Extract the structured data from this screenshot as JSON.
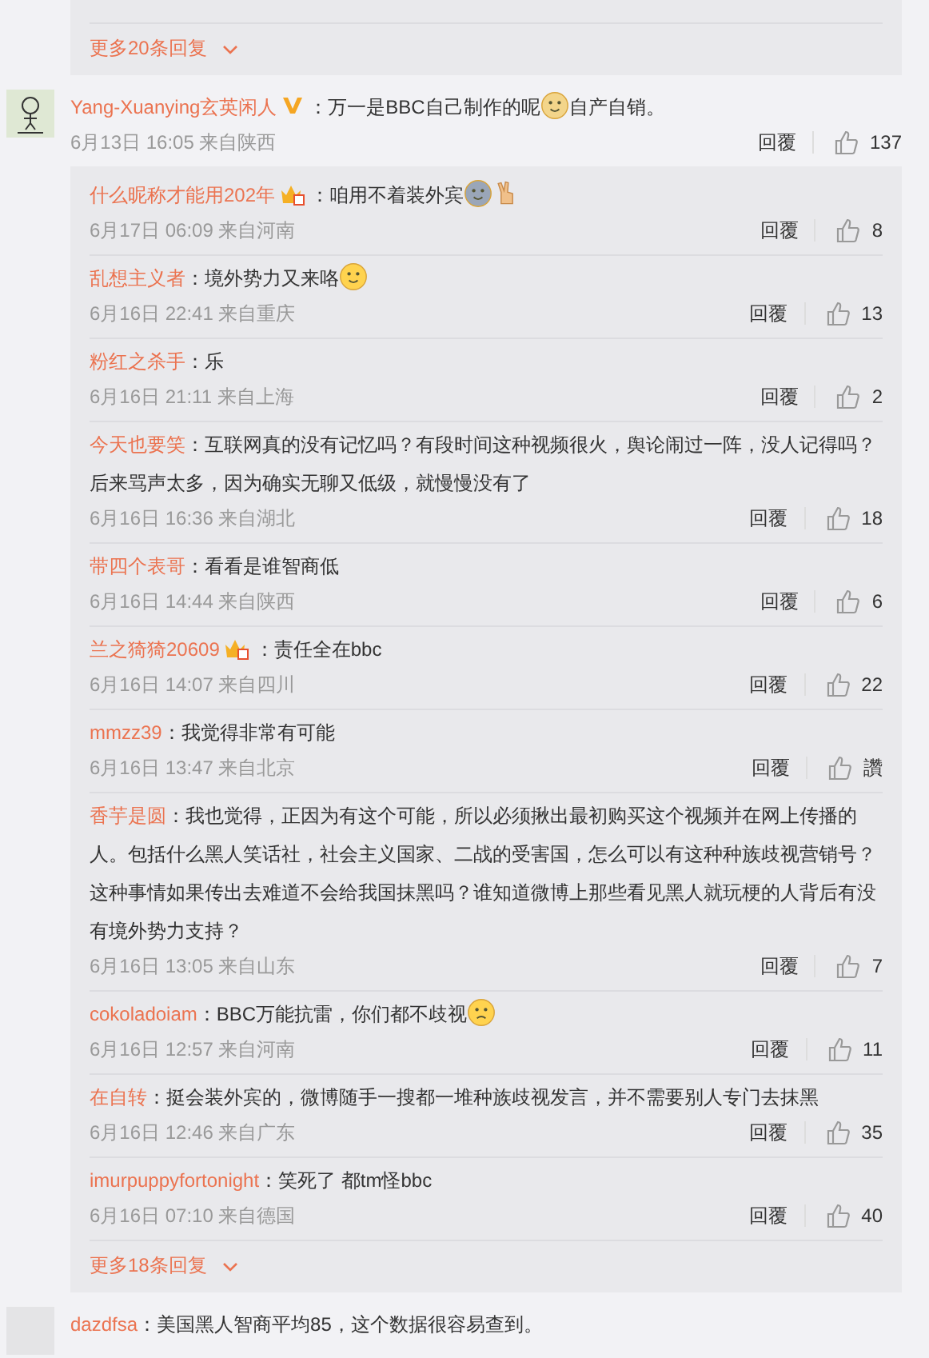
{
  "top_thread_more": {
    "label": "更多20条回复"
  },
  "comments": [
    {
      "author": "Yang-Xuanying玄英闲人",
      "badge": {
        "kind": "verified"
      },
      "content": [
        {
          "kind": "text",
          "text": "：万一是BBC自己制作的呢"
        },
        {
          "kind": "dog"
        },
        {
          "kind": "text",
          "text": "自产自销。"
        }
      ],
      "time": "6月13日 16:05 来自陕西",
      "reply": "回覆",
      "likes": "137",
      "replies": [
        {
          "author": "什么昵称才能用202年",
          "badge": {
            "kind": "member"
          },
          "content": [
            {
              "kind": "text",
              "text": "：咱用不着装外宾"
            },
            {
              "kind": "husky"
            },
            {
              "kind": "peace"
            }
          ],
          "time": "6月17日 06:09 来自河南",
          "reply": "回覆",
          "likes": "8"
        },
        {
          "author": "乱想主义者",
          "content": [
            {
              "kind": "text",
              "text": "：境外势力又来咯"
            },
            {
              "kind": "smile"
            }
          ],
          "time": "6月16日 22:41 来自重庆",
          "reply": "回覆",
          "likes": "13"
        },
        {
          "author": "粉红之杀手",
          "content": [
            {
              "kind": "text",
              "text": "：乐"
            }
          ],
          "time": "6月16日 21:11 来自上海",
          "reply": "回覆",
          "likes": "2"
        },
        {
          "author": "今天也要笑",
          "content": [
            {
              "kind": "text",
              "text": "：互联网真的没有记忆吗？有段时间这种视频很火，舆论闹过一阵，没人记得吗？后来骂声太多，因为确实无聊又低级，就慢慢没有了"
            }
          ],
          "time": "6月16日 16:36 来自湖北",
          "reply": "回覆",
          "likes": "18"
        },
        {
          "author": "带四个表哥",
          "content": [
            {
              "kind": "text",
              "text": "：看看是谁智商低"
            }
          ],
          "time": "6月16日 14:44 来自陕西",
          "reply": "回覆",
          "likes": "6"
        },
        {
          "author": "兰之猗猗20609",
          "badge": {
            "kind": "member"
          },
          "content": [
            {
              "kind": "text",
              "text": "：责任全在bbc"
            }
          ],
          "time": "6月16日 14:07 来自四川",
          "reply": "回覆",
          "likes": "22"
        },
        {
          "author": "mmzz39",
          "content": [
            {
              "kind": "text",
              "text": "：我觉得非常有可能"
            }
          ],
          "time": "6月16日 13:47 来自北京",
          "reply": "回覆",
          "likes": "讚"
        },
        {
          "author": "香芋是圆",
          "content": [
            {
              "kind": "text",
              "text": "：我也觉得，正因为有这个可能，所以必须揪出最初购买这个视频并在网上传播的人。包括什么黑人笑话社，社会主义国家、二战的受害国，怎么可以有这种种族歧视营销号？这种事情如果传出去难道不会给我国抹黑吗？谁知道微博上那些看见黑人就玩梗的人背后有没有境外势力支持？"
            }
          ],
          "time": "6月16日 13:05 来自山东",
          "reply": "回覆",
          "likes": "7"
        },
        {
          "author": "cokoladoiam",
          "content": [
            {
              "kind": "text",
              "text": "：BBC万能抗雷，你们都不歧视"
            },
            {
              "kind": "sad"
            }
          ],
          "time": "6月16日 12:57 来自河南",
          "reply": "回覆",
          "likes": "11"
        },
        {
          "author": "在自转",
          "content": [
            {
              "kind": "text",
              "text": "：挺会装外宾的，微博随手一搜都一堆种族歧视发言，并不需要别人专门去抹黑"
            }
          ],
          "time": "6月16日 12:46 来自广东",
          "reply": "回覆",
          "likes": "35"
        },
        {
          "author": "imurpuppyfortonight",
          "content": [
            {
              "kind": "text",
              "text": "：笑死了 都tm怪bbc"
            }
          ],
          "time": "6月16日 07:10 来自德国",
          "reply": "回覆",
          "likes": "40"
        }
      ],
      "more": {
        "label": "更多18条回复"
      }
    },
    {
      "author": "dazdfsa",
      "avatar": {
        "kind": "blank"
      },
      "content": [
        {
          "kind": "text",
          "text": "：美国黑人智商平均85，这个数据很容易查到。"
        }
      ]
    }
  ]
}
